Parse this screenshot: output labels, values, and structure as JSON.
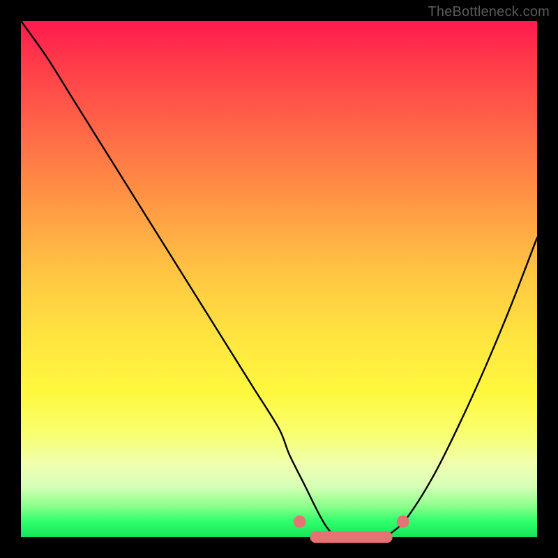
{
  "watermark": {
    "text": "TheBottleneck.com"
  },
  "chart_data": {
    "type": "line",
    "title": "",
    "xlabel": "",
    "ylabel": "",
    "xlim": [
      0,
      100
    ],
    "ylim": [
      0,
      100
    ],
    "grid": false,
    "legend": false,
    "series": [
      {
        "name": "bottleneck-curve",
        "color": "#000000",
        "x": [
          0,
          5,
          10,
          15,
          20,
          25,
          30,
          35,
          40,
          45,
          50,
          52,
          55,
          58,
          60,
          62,
          65,
          68,
          70,
          72,
          75,
          80,
          85,
          90,
          95,
          100
        ],
        "y": [
          100,
          93,
          85,
          77,
          69,
          61,
          53,
          45,
          37,
          29,
          21,
          16,
          10,
          4,
          1,
          0,
          0,
          0,
          0,
          1,
          4,
          12,
          22,
          33,
          45,
          58
        ]
      }
    ],
    "markers": [
      {
        "name": "flat-region",
        "color": "#e57373",
        "shape": "pill",
        "x": [
          56,
          72
        ],
        "y": 0,
        "widthPct": 16,
        "heightPct": 2.3
      },
      {
        "name": "left-knee-dot",
        "color": "#e57373",
        "shape": "dot",
        "x": 54,
        "y": 3,
        "rPct": 1.2
      },
      {
        "name": "right-knee-dot",
        "color": "#e57373",
        "shape": "dot",
        "x": 74,
        "y": 3,
        "rPct": 1.2
      }
    ],
    "annotations": []
  }
}
